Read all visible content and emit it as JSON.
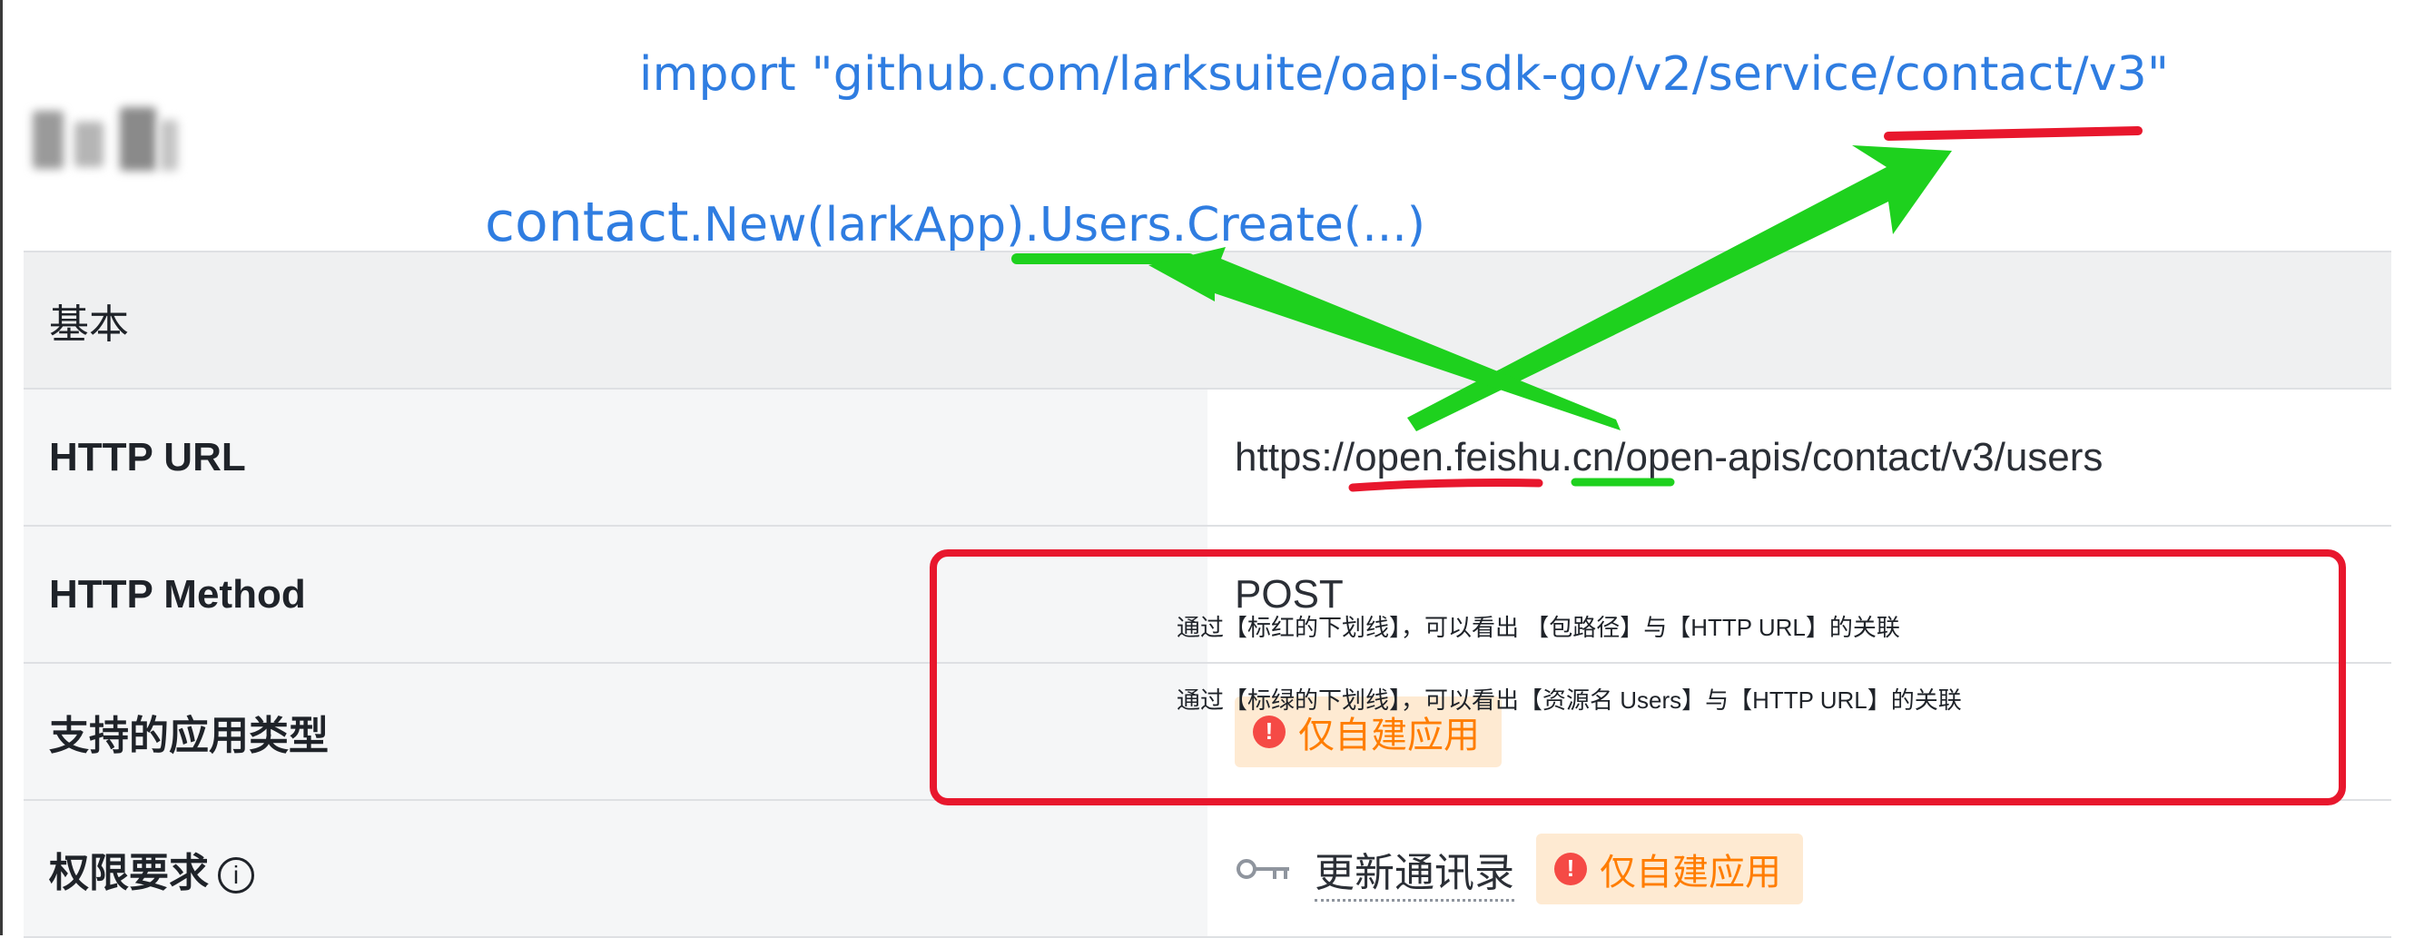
{
  "annotations": {
    "import_line": "import \"github.com/larksuite/oapi-sdk-go/v2/service/contact/v3\"",
    "code_pkg": "contact",
    "code_rest": ".New(larkApp).Users.Create(...)",
    "note_line_1": "通过【标红的下划线】，可以看出 【包路径】与【HTTP URL】的关联",
    "note_line_2": "通过【标绿的下划线】，可以看出【资源名 Users】与【HTTP URL】的关联",
    "colors": {
      "text_blue": "#2f7de1",
      "red": "#e8172d",
      "green": "#1ed11e"
    }
  },
  "table": {
    "section_title": "基本",
    "rows": {
      "url": {
        "key": "HTTP URL",
        "value_prefix": "https://open.feishu.cn/open-apis/",
        "value_contact": "contact",
        "value_slash1": "/",
        "value_v3": "v3",
        "value_slash2": "/",
        "value_users": "users"
      },
      "method": {
        "key": "HTTP Method",
        "value": "POST"
      },
      "app_type": {
        "key": "支持的应用类型",
        "tag": "仅自建应用",
        "tag_icon": "exclamation-icon"
      },
      "permission": {
        "key": "权限要求",
        "info_icon": "i",
        "scope_icon": "key-icon",
        "scope": "更新通讯录",
        "tag": "仅自建应用",
        "tag_icon": "exclamation-icon"
      }
    },
    "colors": {
      "section_bg": "#eff0f1",
      "key_bg": "#f5f6f7",
      "tag_bg": "#feead2",
      "tag_text": "#ff7d00",
      "warn": "#f54a45"
    }
  }
}
